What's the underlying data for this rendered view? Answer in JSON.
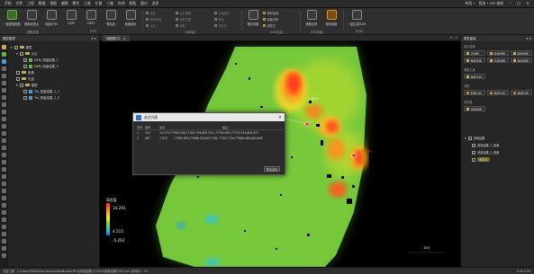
{
  "menu": {
    "items": [
      "开始",
      "文件",
      "工程",
      "数据",
      "地图",
      "编辑",
      "数字",
      "工具",
      "扩展",
      "三维",
      "在线",
      "帮助",
      "窗口",
      "选项"
    ],
    "right_text": "布局 •",
    "user": "登录 • DPI 缩放"
  },
  "ribbon": {
    "buttons": [
      {
        "label": "一键提取数据"
      },
      {
        "label": "提取地表点"
      },
      {
        "label": "地面DTM"
      },
      {
        "label": "DSM"
      },
      {
        "label": "DEM"
      },
      {
        "label": "等高线"
      },
      {
        "label": "坡度坡向"
      },
      {
        "label": "提取边界"
      },
      {
        "label": "修改精度"
      },
      {
        "label": "一键生成DOM"
      }
    ],
    "small_a": [
      "投影",
      "投影转换",
      "合并",
      "合并栅格",
      "提取范围",
      "提取"
    ],
    "small_b": [
      "分幅裁切",
      "配准",
      "重采样",
      "格式转换"
    ],
    "small_c": [
      "体积量测",
      "剖面分析",
      "填挖方"
    ],
    "groups": [
      "数据处理",
      "DTM",
      "TIN构建",
      "DOM生成",
      "DSM构建",
      "DOM"
    ]
  },
  "left_panel": {
    "title": "图层管理",
    "tree": [
      {
        "label": "图层",
        "level": 0,
        "kind": "folder",
        "checked": true
      },
      {
        "label": "点云",
        "level": 1,
        "kind": "folder",
        "checked": true
      },
      {
        "label": "DEM_测量结果_1",
        "level": 2,
        "kind": "layer",
        "checked": true
      },
      {
        "label": "DEM_测量结果_2",
        "level": 2,
        "kind": "layer",
        "checked": true
      },
      {
        "label": "影像",
        "level": 1,
        "kind": "folder",
        "checked": false
      },
      {
        "label": "矢量",
        "level": 1,
        "kind": "folder",
        "checked": false
      },
      {
        "label": "模型",
        "level": 1,
        "kind": "folder",
        "checked": false
      },
      {
        "label": "Tin_测量结果_1_1",
        "level": 2,
        "kind": "layer",
        "checked": false
      },
      {
        "label": "Tin_测量结果_1_2",
        "level": 2,
        "kind": "layer",
        "checked": false
      }
    ]
  },
  "doc_tab": {
    "label": "地图窗口1",
    "close": "×"
  },
  "viewport": {
    "legend": {
      "title": "高程值",
      "max": "14.291",
      "mid": "4.515",
      "min": "-5.262"
    },
    "annotations": [
      {
        "text": "3.56m"
      },
      {
        "text": "2.375m"
      }
    ],
    "scale_label": "100"
  },
  "dialog": {
    "title": "选点列表",
    "close": "×",
    "columns": [
      "序号",
      "编号",
      "坐标",
      "备注"
    ],
    "rows": [
      [
        "1",
        "203",
        "10.370 77390.146,77705.759,600.374, 77765.855,77707.874,600.477",
        ""
      ],
      [
        "2",
        "407",
        "7.375",
        "77565.693,77688.730,607.798, 77307.734,77688.468,600.406"
      ]
    ],
    "ok_label": "导出坐标"
  },
  "right_panel": {
    "title": "属性面板",
    "sections": [
      "标注设置",
      "测量工具",
      "分析",
      "可见性"
    ],
    "buttons_row1": [
      "点测量",
      "距离测量",
      "面积测量"
    ],
    "buttons_row2": [
      "角度测量",
      "高程测量",
      "体积测量"
    ],
    "buttons_row3": [
      "坡度分析"
    ],
    "buttons_row4": [
      "剖面分析",
      "填挖分析",
      "通视分析"
    ],
    "buttons_row5": [
      "清除测量"
    ],
    "tree": [
      {
        "label": "测量结果",
        "checked": true
      },
      {
        "label": "测量结果_1_剖面",
        "checked": true
      },
      {
        "label": "测量结果_2_剖面",
        "checked": true
      },
      {
        "label": "测量点",
        "checked": false
      }
    ]
  },
  "status": {
    "text": "当前工程：C:/Users/YWS2/Documents/GeoBuilder/Proj/测量结果(2)/2025/测量结果/2025.xxi (未保存)：10",
    "right": "0.00 0.00"
  }
}
